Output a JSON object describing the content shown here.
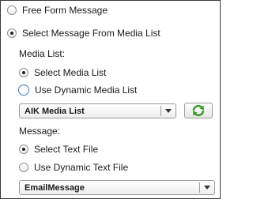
{
  "options": {
    "free_form": "Free Form Message",
    "from_media_list": "Select Message From Media List"
  },
  "media": {
    "heading": "Media List:",
    "select_media_list": "Select Media List",
    "use_dynamic_media_list": "Use Dynamic Media List",
    "dropdown_value": "AIK Media List",
    "refresh_icon": "refresh-icon"
  },
  "message": {
    "heading": "Message:",
    "select_text_file": "Select Text File",
    "use_dynamic_text_file": "Use Dynamic Text File",
    "dropdown_value": "EmailMessage"
  },
  "colors": {
    "refresh_green": "#3a9a2a",
    "radio_focus_blue": "#3f78b4"
  }
}
